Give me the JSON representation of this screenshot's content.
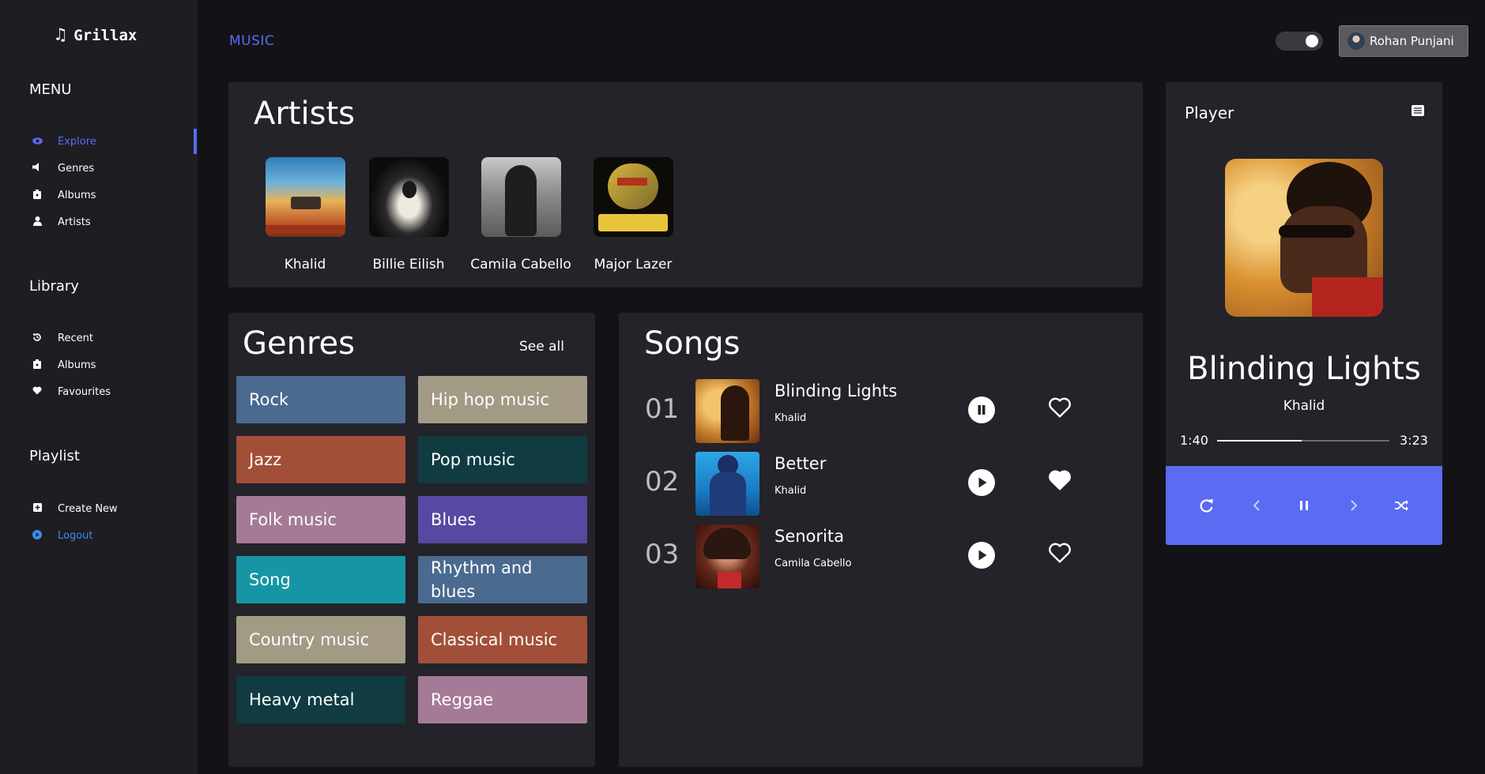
{
  "app": {
    "name": "Grillax"
  },
  "sidebar": {
    "menu_title": "MENU",
    "menu_items": [
      {
        "label": "Explore",
        "icon": "eye-icon",
        "active": true
      },
      {
        "label": "Genres",
        "icon": "speaker-icon"
      },
      {
        "label": "Albums",
        "icon": "album-icon"
      },
      {
        "label": "Artists",
        "icon": "user-icon"
      }
    ],
    "library_title": "Library",
    "library_items": [
      {
        "label": "Recent",
        "icon": "history-icon"
      },
      {
        "label": "Albums",
        "icon": "album-icon"
      },
      {
        "label": "Favourites",
        "icon": "heart-icon"
      }
    ],
    "playlist_title": "Playlist",
    "playlist_items": [
      {
        "label": "Create New",
        "icon": "plus-square-icon"
      },
      {
        "label": "Logout",
        "icon": "logout-icon"
      }
    ]
  },
  "header": {
    "section": "MUSIC",
    "user_name": "Rohan Punjani",
    "accent": "#5a6cf2"
  },
  "artists": {
    "title": "Artists",
    "items": [
      {
        "name": "Khalid"
      },
      {
        "name": "Billie Eilish"
      },
      {
        "name": "Camila Cabello"
      },
      {
        "name": "Major Lazer"
      }
    ]
  },
  "genres": {
    "title": "Genres",
    "see_all": "See all",
    "items": [
      {
        "label": "Rock",
        "color": "#4a6a8f"
      },
      {
        "label": "Hip hop music",
        "color": "#a39a86"
      },
      {
        "label": "Jazz",
        "color": "#a24f39"
      },
      {
        "label": "Pop music",
        "color": "#0f3b41"
      },
      {
        "label": "Folk music",
        "color": "#a57a96"
      },
      {
        "label": "Blues",
        "color": "#5649a2"
      },
      {
        "label": "Song",
        "color": "#1696a5"
      },
      {
        "label": "Rhythm and blues",
        "color": "#4a6a8f"
      },
      {
        "label": "Country music",
        "color": "#a39a86"
      },
      {
        "label": "Classical music",
        "color": "#a24f39"
      },
      {
        "label": "Heavy metal",
        "color": "#0f3b41"
      },
      {
        "label": "Reggae",
        "color": "#a57a96"
      }
    ]
  },
  "songs": {
    "title": "Songs",
    "items": [
      {
        "num": "01",
        "title": "Blinding Lights",
        "artist": "Khalid",
        "state": "pause",
        "liked": false
      },
      {
        "num": "02",
        "title": "Better",
        "artist": "Khalid",
        "state": "play",
        "liked": true
      },
      {
        "num": "03",
        "title": "Senorita",
        "artist": "Camila Cabello",
        "state": "play",
        "liked": false
      }
    ]
  },
  "player": {
    "title": "Player",
    "now_title": "Blinding Lights",
    "now_artist": "Khalid",
    "elapsed": "1:40",
    "duration": "3:23",
    "progress": 0.49
  }
}
